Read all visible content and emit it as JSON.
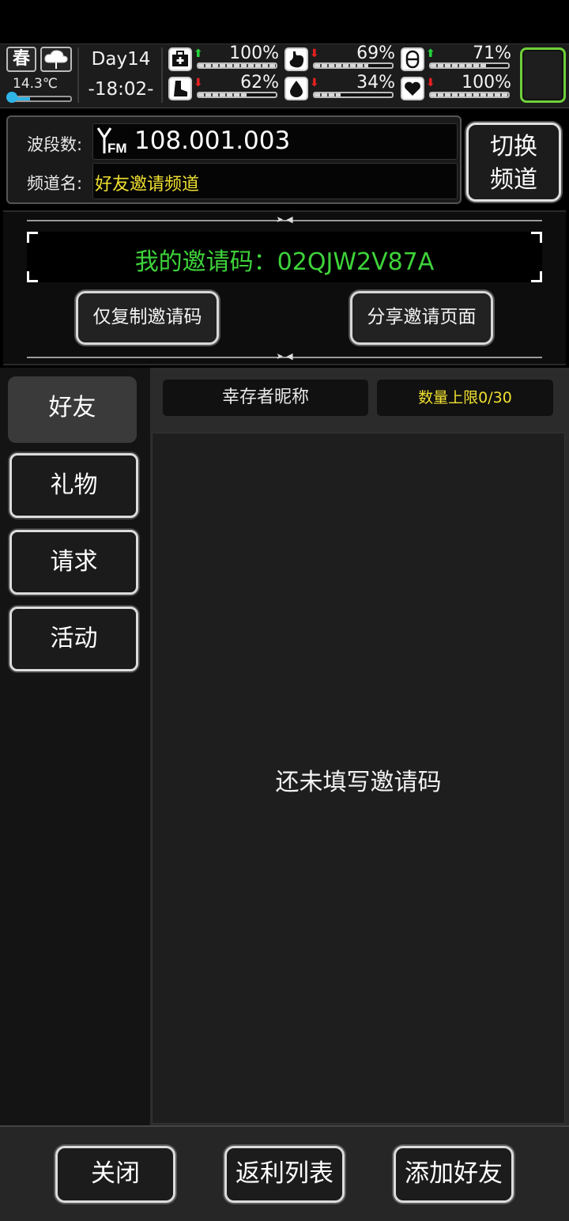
{
  "status": {
    "season": "春",
    "weather_icon": "cloud-rain-icon",
    "temperature": "14.3℃",
    "temperature_level": 0.3,
    "day": "Day14",
    "time": "-18:02-",
    "stats": [
      {
        "name": "health",
        "icon": "medkit-icon",
        "trend": "up",
        "value": "100%",
        "level": 1.0
      },
      {
        "name": "hunger",
        "icon": "stomach-icon",
        "trend": "down",
        "value": "69%",
        "level": 0.69
      },
      {
        "name": "medicine",
        "icon": "pill-icon",
        "trend": "up",
        "value": "71%",
        "level": 0.71
      },
      {
        "name": "stamina",
        "icon": "boot-icon",
        "trend": "down",
        "value": "62%",
        "level": 0.62
      },
      {
        "name": "thirst",
        "icon": "water-drop-icon",
        "trend": "down",
        "value": "34%",
        "level": 0.34
      },
      {
        "name": "mood",
        "icon": "heart-icon",
        "trend": "down",
        "value": "100%",
        "level": 1.0
      }
    ],
    "accent_green": "#6fcf3a"
  },
  "channel": {
    "freq_label": "波段数:",
    "freq_icon": "FM",
    "freq_value": "108.001.003",
    "name_label": "频道名:",
    "name_value": "好友邀请频道",
    "switch_line1": "切换",
    "switch_line2": "频道"
  },
  "invite": {
    "code_text": "我的邀请码：02QJW2V87A",
    "copy_button": "仅复制邀请码",
    "share_button": "分享邀请页面"
  },
  "tabs": [
    {
      "label": "好友",
      "active": true
    },
    {
      "label": "礼物",
      "active": false
    },
    {
      "label": "请求",
      "active": false
    },
    {
      "label": "活动",
      "active": false
    }
  ],
  "list": {
    "col_name": "幸存者昵称",
    "col_limit": "数量上限0/30",
    "empty_message": "还未填写邀请码"
  },
  "footer": {
    "close": "关闭",
    "rebate_list": "返利列表",
    "add_friend": "添加好友"
  }
}
